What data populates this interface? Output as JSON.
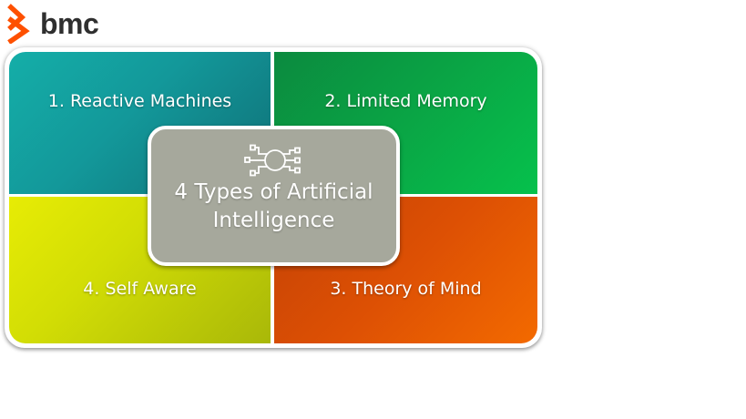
{
  "logo": {
    "text": "bmc",
    "mark_color": "#fe5000"
  },
  "diagram": {
    "center_title": "4 Types of Artificial Intelligence",
    "center_icon": "ai-circuit-icon",
    "quadrants": [
      {
        "label": "1. Reactive Machines",
        "color": "#13989a"
      },
      {
        "label": "2. Limited Memory",
        "color": "#0aa545"
      },
      {
        "label": "3. Theory of Mind",
        "color": "#e55a03"
      },
      {
        "label": "4. Self Aware",
        "color": "#cfd905"
      }
    ]
  }
}
